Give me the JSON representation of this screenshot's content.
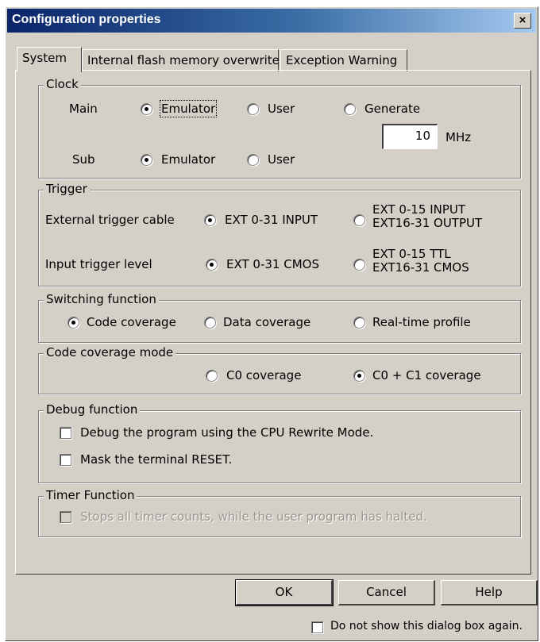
{
  "dialog": {
    "title": "Configuration properties",
    "close_glyph": "×"
  },
  "tabs": [
    {
      "label": "System",
      "active": true
    },
    {
      "label": "Internal flash memory overwrite",
      "active": false
    },
    {
      "label": "Exception Warning",
      "active": false
    }
  ],
  "clock": {
    "legend": "Clock",
    "main_label": "Main",
    "sub_label": "Sub",
    "main_options": [
      "Emulator",
      "User",
      "Generate"
    ],
    "main_selected": "Emulator",
    "sub_options": [
      "Emulator",
      "User"
    ],
    "sub_selected": "Emulator",
    "frequency_value": "10",
    "frequency_unit": "MHz"
  },
  "trigger": {
    "legend": "Trigger",
    "cable_label": "External trigger cable",
    "cable_option1": "EXT 0-31  INPUT",
    "cable_option2_line1": "EXT 0-15  INPUT",
    "cable_option2_line2": "EXT16-31  OUTPUT",
    "cable_selected": 1,
    "level_label": "Input trigger level",
    "level_option1": "EXT 0-31  CMOS",
    "level_option2_line1": "EXT 0-15  TTL",
    "level_option2_line2": "EXT16-31  CMOS",
    "level_selected": 1
  },
  "switching": {
    "legend": "Switching function",
    "options": [
      "Code coverage",
      "Data coverage",
      "Real-time profile"
    ],
    "selected": "Code coverage"
  },
  "coverage_mode": {
    "legend": "Code coverage mode",
    "options": [
      "C0 coverage",
      "C0 + C1 coverage"
    ],
    "selected": "C0 + C1 coverage"
  },
  "debug": {
    "legend": "Debug function",
    "rewrite_mode_label": "Debug the program using the CPU Rewrite Mode.",
    "rewrite_mode_checked": false,
    "mask_reset_label": "Mask the terminal RESET.",
    "mask_reset_checked": false
  },
  "timer": {
    "legend": "Timer Function",
    "stop_label": "Stops all timer counts, while the user program has halted.",
    "stop_checked": false,
    "enabled": false
  },
  "buttons": {
    "ok": "OK",
    "cancel": "Cancel",
    "help": "Help"
  },
  "footer": {
    "dont_show_label": "Do not show this dialog box again.",
    "dont_show_checked": false
  },
  "colors": {
    "face": "#d4d0c8",
    "title_start": "#0a246a",
    "title_end": "#a6caf0"
  }
}
